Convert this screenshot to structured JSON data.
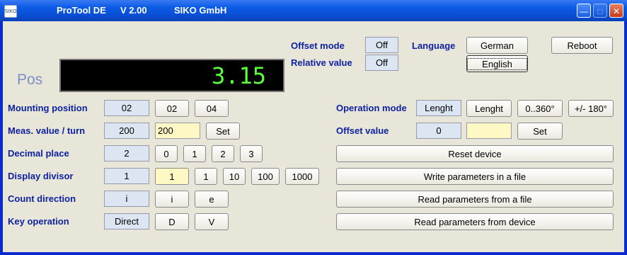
{
  "window": {
    "icon_text": "SIKO",
    "title_app": "ProTool DE",
    "title_version": "V 2.00",
    "title_company": "SIKO GmbH"
  },
  "titlebar_buttons": [
    "minimize-icon",
    "maximize-icon",
    "close-icon"
  ],
  "display": {
    "label": "Pos",
    "value": "3.15",
    "value_color": "#5cff3c"
  },
  "offset_mode": {
    "label": "Offset mode",
    "value": "Off"
  },
  "relative_value": {
    "label": "Relative value",
    "value": "Off"
  },
  "language": {
    "label": "Language",
    "options": [
      "German",
      "English"
    ],
    "selected": "English"
  },
  "reboot": {
    "label": "Reboot"
  },
  "mounting_position": {
    "label": "Mounting position",
    "value": "02",
    "options": [
      "02",
      "04"
    ]
  },
  "meas_value": {
    "label": "Meas. value / turn",
    "value": "200",
    "input": "200",
    "set": "Set"
  },
  "decimal_place": {
    "label": "Decimal place",
    "value": "2",
    "options": [
      "0",
      "1",
      "2",
      "3"
    ]
  },
  "display_divisor": {
    "label": "Display divisor",
    "value": "1",
    "selected_input": "1",
    "options": [
      "1",
      "10",
      "100",
      "1000"
    ]
  },
  "count_direction": {
    "label": "Count direction",
    "value": "i",
    "options": [
      "i",
      "e"
    ]
  },
  "key_operation": {
    "label": "Key operation",
    "value": "Direct",
    "options": [
      "D",
      "V"
    ]
  },
  "operation_mode": {
    "label": "Operation mode",
    "value": "Lenght",
    "options": [
      "Lenght",
      "0..360°",
      "+/- 180°"
    ]
  },
  "offset_value": {
    "label": "Offset value",
    "value": "0",
    "input": "",
    "set": "Set"
  },
  "actions": {
    "reset": "Reset device",
    "write": "Write parameters in a file",
    "read_file": "Read parameters from a file",
    "read_device": "Read parameters from device"
  },
  "colors": {
    "title_bar": "#0b5be6",
    "label": "#0f22a0",
    "client_bg": "#e8e5d9",
    "input_bg": "#fef8c4",
    "field_bg": "#dce6f2"
  }
}
